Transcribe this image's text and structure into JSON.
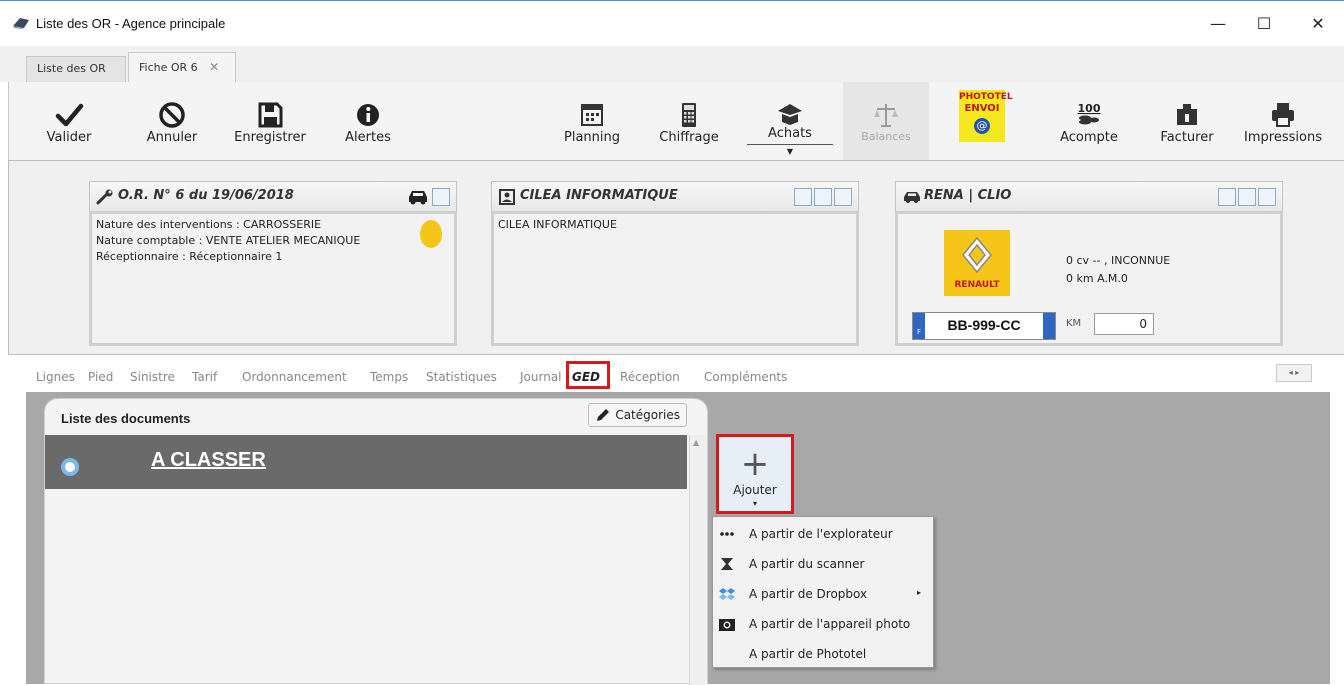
{
  "window": {
    "title": "Liste des OR - Agence principale",
    "minimize": "—",
    "maximize": "☐",
    "close": "✕"
  },
  "tabs": [
    {
      "label": "Liste des OR"
    },
    {
      "label": "Fiche OR 6",
      "close": "✕"
    }
  ],
  "toolbar": {
    "valider": "Valider",
    "annuler": "Annuler",
    "enregistrer": "Enregistrer",
    "alertes": "Alertes",
    "planning": "Planning",
    "chiffrage": "Chiffrage",
    "achats": "Achats",
    "balances": "Balances",
    "phototel_line1": "PHOTOTEL",
    "phototel_line2": "ENVOI",
    "acompte": "Acompte",
    "acompte_icon_text": "100",
    "facturer": "Facturer",
    "impressions": "Impressions"
  },
  "or_panel": {
    "title": "O.R. N° 6 du 19/06/2018",
    "lines": [
      "Nature des interventions : CARROSSERIE",
      "Nature comptable : VENTE ATELIER MECANIQUE",
      "Réceptionnaire  : Réceptionnaire 1"
    ]
  },
  "client_panel": {
    "title": "CILEA INFORMATIQUE",
    "body": "CILEA INFORMATIQUE"
  },
  "vehicle_panel": {
    "title": "RENA | CLIO",
    "brand": "RENAULT",
    "line1": "0 cv -- , INCONNUE",
    "line2": "0 km A.M.0",
    "plate": "BB-999-CC",
    "plate_country": "F",
    "km_label": "KM",
    "km_value": "0"
  },
  "subtabs": [
    "Lignes",
    "Pied",
    "Sinistre",
    "Tarif",
    "Ordonnancement",
    "Temps",
    "Statistiques",
    "Journal",
    "GED",
    "Réception",
    "Compléments"
  ],
  "scroll_arrows": "◂ ▸",
  "documents": {
    "title": "Liste des documents",
    "categories_button": "Catégories",
    "folder": "A CLASSER"
  },
  "ajouter": {
    "plus": "+",
    "label": "Ajouter",
    "arrow": "▾"
  },
  "menu": {
    "items": [
      {
        "label": "A partir de l'explorateur",
        "icon": "dots-icon"
      },
      {
        "label": "A partir du scanner",
        "icon": "scanner-icon"
      },
      {
        "label": "A partir de Dropbox",
        "icon": "dropbox-icon",
        "submenu": "▸"
      },
      {
        "label": "A partir de l'appareil photo",
        "icon": "camera-icon"
      },
      {
        "label": "A partir de Phototel",
        "icon": ""
      }
    ]
  },
  "colors": {
    "highlight_red": "#d41a1a",
    "folder_bg": "#6a6a6a",
    "main_gray": "#a8a8a8"
  }
}
